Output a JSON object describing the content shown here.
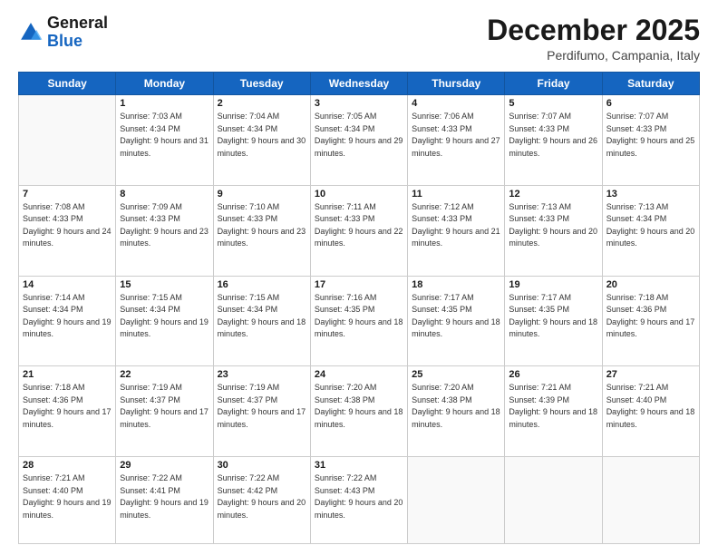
{
  "header": {
    "logo_line1": "General",
    "logo_line2": "Blue",
    "month_title": "December 2025",
    "location": "Perdifumo, Campania, Italy"
  },
  "weekdays": [
    "Sunday",
    "Monday",
    "Tuesday",
    "Wednesday",
    "Thursday",
    "Friday",
    "Saturday"
  ],
  "weeks": [
    [
      null,
      {
        "day": 1,
        "sunrise": "7:03 AM",
        "sunset": "4:34 PM",
        "daylight": "9 hours and 31 minutes."
      },
      {
        "day": 2,
        "sunrise": "7:04 AM",
        "sunset": "4:34 PM",
        "daylight": "9 hours and 30 minutes."
      },
      {
        "day": 3,
        "sunrise": "7:05 AM",
        "sunset": "4:34 PM",
        "daylight": "9 hours and 29 minutes."
      },
      {
        "day": 4,
        "sunrise": "7:06 AM",
        "sunset": "4:33 PM",
        "daylight": "9 hours and 27 minutes."
      },
      {
        "day": 5,
        "sunrise": "7:07 AM",
        "sunset": "4:33 PM",
        "daylight": "9 hours and 26 minutes."
      },
      {
        "day": 6,
        "sunrise": "7:07 AM",
        "sunset": "4:33 PM",
        "daylight": "9 hours and 25 minutes."
      }
    ],
    [
      {
        "day": 7,
        "sunrise": "7:08 AM",
        "sunset": "4:33 PM",
        "daylight": "9 hours and 24 minutes."
      },
      {
        "day": 8,
        "sunrise": "7:09 AM",
        "sunset": "4:33 PM",
        "daylight": "9 hours and 23 minutes."
      },
      {
        "day": 9,
        "sunrise": "7:10 AM",
        "sunset": "4:33 PM",
        "daylight": "9 hours and 23 minutes."
      },
      {
        "day": 10,
        "sunrise": "7:11 AM",
        "sunset": "4:33 PM",
        "daylight": "9 hours and 22 minutes."
      },
      {
        "day": 11,
        "sunrise": "7:12 AM",
        "sunset": "4:33 PM",
        "daylight": "9 hours and 21 minutes."
      },
      {
        "day": 12,
        "sunrise": "7:13 AM",
        "sunset": "4:33 PM",
        "daylight": "9 hours and 20 minutes."
      },
      {
        "day": 13,
        "sunrise": "7:13 AM",
        "sunset": "4:34 PM",
        "daylight": "9 hours and 20 minutes."
      }
    ],
    [
      {
        "day": 14,
        "sunrise": "7:14 AM",
        "sunset": "4:34 PM",
        "daylight": "9 hours and 19 minutes."
      },
      {
        "day": 15,
        "sunrise": "7:15 AM",
        "sunset": "4:34 PM",
        "daylight": "9 hours and 19 minutes."
      },
      {
        "day": 16,
        "sunrise": "7:15 AM",
        "sunset": "4:34 PM",
        "daylight": "9 hours and 18 minutes."
      },
      {
        "day": 17,
        "sunrise": "7:16 AM",
        "sunset": "4:35 PM",
        "daylight": "9 hours and 18 minutes."
      },
      {
        "day": 18,
        "sunrise": "7:17 AM",
        "sunset": "4:35 PM",
        "daylight": "9 hours and 18 minutes."
      },
      {
        "day": 19,
        "sunrise": "7:17 AM",
        "sunset": "4:35 PM",
        "daylight": "9 hours and 18 minutes."
      },
      {
        "day": 20,
        "sunrise": "7:18 AM",
        "sunset": "4:36 PM",
        "daylight": "9 hours and 17 minutes."
      }
    ],
    [
      {
        "day": 21,
        "sunrise": "7:18 AM",
        "sunset": "4:36 PM",
        "daylight": "9 hours and 17 minutes."
      },
      {
        "day": 22,
        "sunrise": "7:19 AM",
        "sunset": "4:37 PM",
        "daylight": "9 hours and 17 minutes."
      },
      {
        "day": 23,
        "sunrise": "7:19 AM",
        "sunset": "4:37 PM",
        "daylight": "9 hours and 17 minutes."
      },
      {
        "day": 24,
        "sunrise": "7:20 AM",
        "sunset": "4:38 PM",
        "daylight": "9 hours and 18 minutes."
      },
      {
        "day": 25,
        "sunrise": "7:20 AM",
        "sunset": "4:38 PM",
        "daylight": "9 hours and 18 minutes."
      },
      {
        "day": 26,
        "sunrise": "7:21 AM",
        "sunset": "4:39 PM",
        "daylight": "9 hours and 18 minutes."
      },
      {
        "day": 27,
        "sunrise": "7:21 AM",
        "sunset": "4:40 PM",
        "daylight": "9 hours and 18 minutes."
      }
    ],
    [
      {
        "day": 28,
        "sunrise": "7:21 AM",
        "sunset": "4:40 PM",
        "daylight": "9 hours and 19 minutes."
      },
      {
        "day": 29,
        "sunrise": "7:22 AM",
        "sunset": "4:41 PM",
        "daylight": "9 hours and 19 minutes."
      },
      {
        "day": 30,
        "sunrise": "7:22 AM",
        "sunset": "4:42 PM",
        "daylight": "9 hours and 20 minutes."
      },
      {
        "day": 31,
        "sunrise": "7:22 AM",
        "sunset": "4:43 PM",
        "daylight": "9 hours and 20 minutes."
      },
      null,
      null,
      null
    ]
  ]
}
